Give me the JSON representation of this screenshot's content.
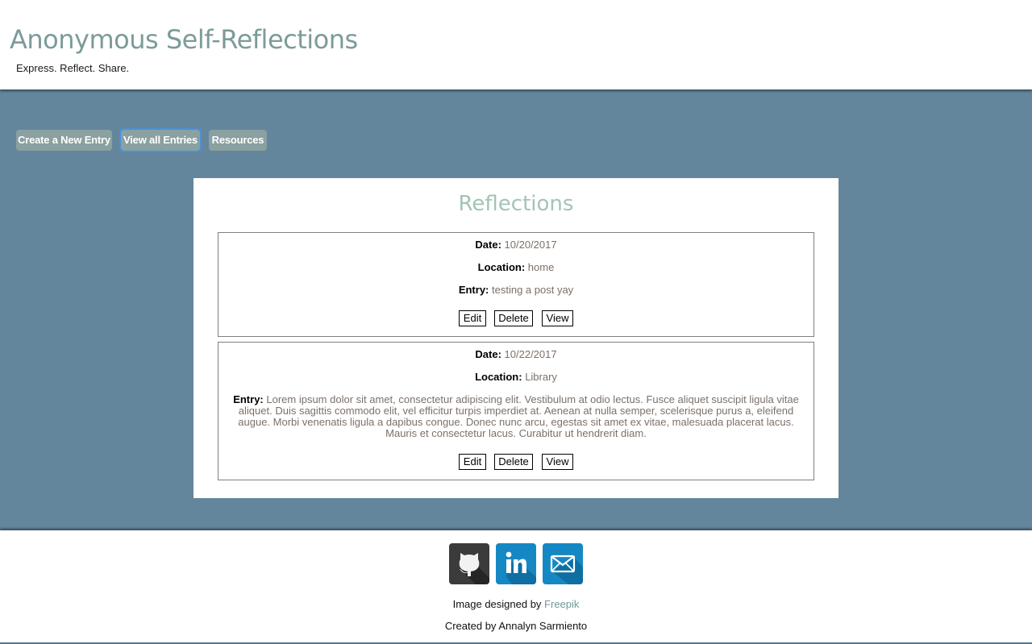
{
  "header": {
    "title": "Anonymous Self-Reflections",
    "tagline": "Express. Reflect. Share."
  },
  "nav": {
    "items": [
      {
        "label": "Create a New Entry"
      },
      {
        "label": "View all Entries",
        "focused": true
      },
      {
        "label": "Resources"
      }
    ]
  },
  "main": {
    "title": "Reflections",
    "labels": {
      "date": "Date:",
      "location": "Location:",
      "entry": "Entry:"
    },
    "actions": {
      "edit": "Edit",
      "delete": "Delete",
      "view": "View"
    },
    "entries": [
      {
        "date": "10/20/2017",
        "location": "home",
        "entry": "testing a post yay"
      },
      {
        "date": "10/22/2017",
        "location": "Library",
        "entry": "Lorem ipsum dolor sit amet, consectetur adipiscing elit. Vestibulum at odio lectus. Fusce aliquet suscipit ligula vitae aliquet. Duis sagittis commodo elit, vel efficitur turpis imperdiet at. Aenean at nulla semper, scelerisque purus a, eleifend augue. Morbi venenatis ligula a dapibus congue. Donec nunc arcu, egestas sit amet ex vitae, malesuada placerat lacus. Mauris et consectetur lacus. Curabitur ut hendrerit diam."
      }
    ]
  },
  "footer": {
    "social": [
      {
        "icon": "github-icon",
        "color": "#3b3b3b"
      },
      {
        "icon": "linkedin-icon",
        "color": "#1588c4"
      },
      {
        "icon": "email-icon",
        "color": "#1588c4"
      }
    ],
    "credit_prefix": "Image designed by ",
    "credit_link": "Freepik",
    "created_by": "Created by Annalyn Sarmiento"
  },
  "colors": {
    "background": "#64869c",
    "title": "#7c9b9a",
    "panel_title": "#a3c4b4",
    "value_text": "#7d7068",
    "nav_button": "#8aa0a1"
  }
}
